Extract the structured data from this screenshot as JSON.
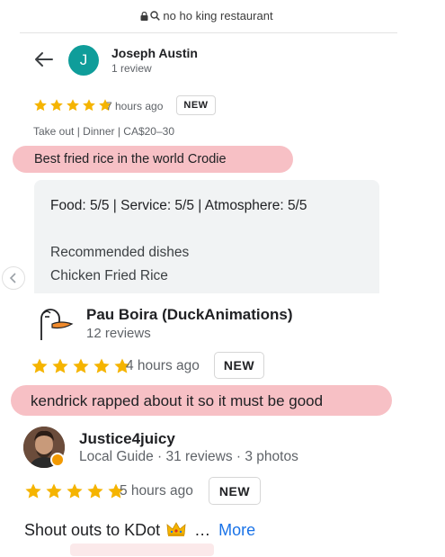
{
  "url_bar": {
    "text": "no ho king restaurant",
    "lock_icon": "lock-icon",
    "search_icon": "search-icon"
  },
  "review1": {
    "avatar_letter": "J",
    "avatar_color": "#0f9d9a",
    "name": "Joseph Austin",
    "review_count": "1 review",
    "rating": 5,
    "time": "7 hours ago",
    "badge": "NEW",
    "meta": "Take out  |  Dinner  |  CA$20–30",
    "text": "Best fried rice in the world Crodie",
    "ratings_line": "Food: 5/5  |  Service: 5/5  |  Atmosphere: 5/5",
    "recommended_label": "Recommended dishes",
    "recommended_value": "Chicken Fried Rice"
  },
  "review2": {
    "name": "Pau Boira (DuckAnimations)",
    "review_count": "12 reviews",
    "rating": 5,
    "time": "4 hours ago",
    "badge": "NEW",
    "text": "kendrick rapped about it so it must be good"
  },
  "review3": {
    "name": "Justice4juicy",
    "sub": "Local Guide · 31 reviews · 3 photos",
    "rating": 5,
    "time": "5 hours ago",
    "badge": "NEW",
    "text": "Shout outs to KDot",
    "ellipsis": "…",
    "more": "More"
  },
  "colors": {
    "star": "#f5b400",
    "highlight": "#f08c96",
    "link": "#1a73e8"
  }
}
